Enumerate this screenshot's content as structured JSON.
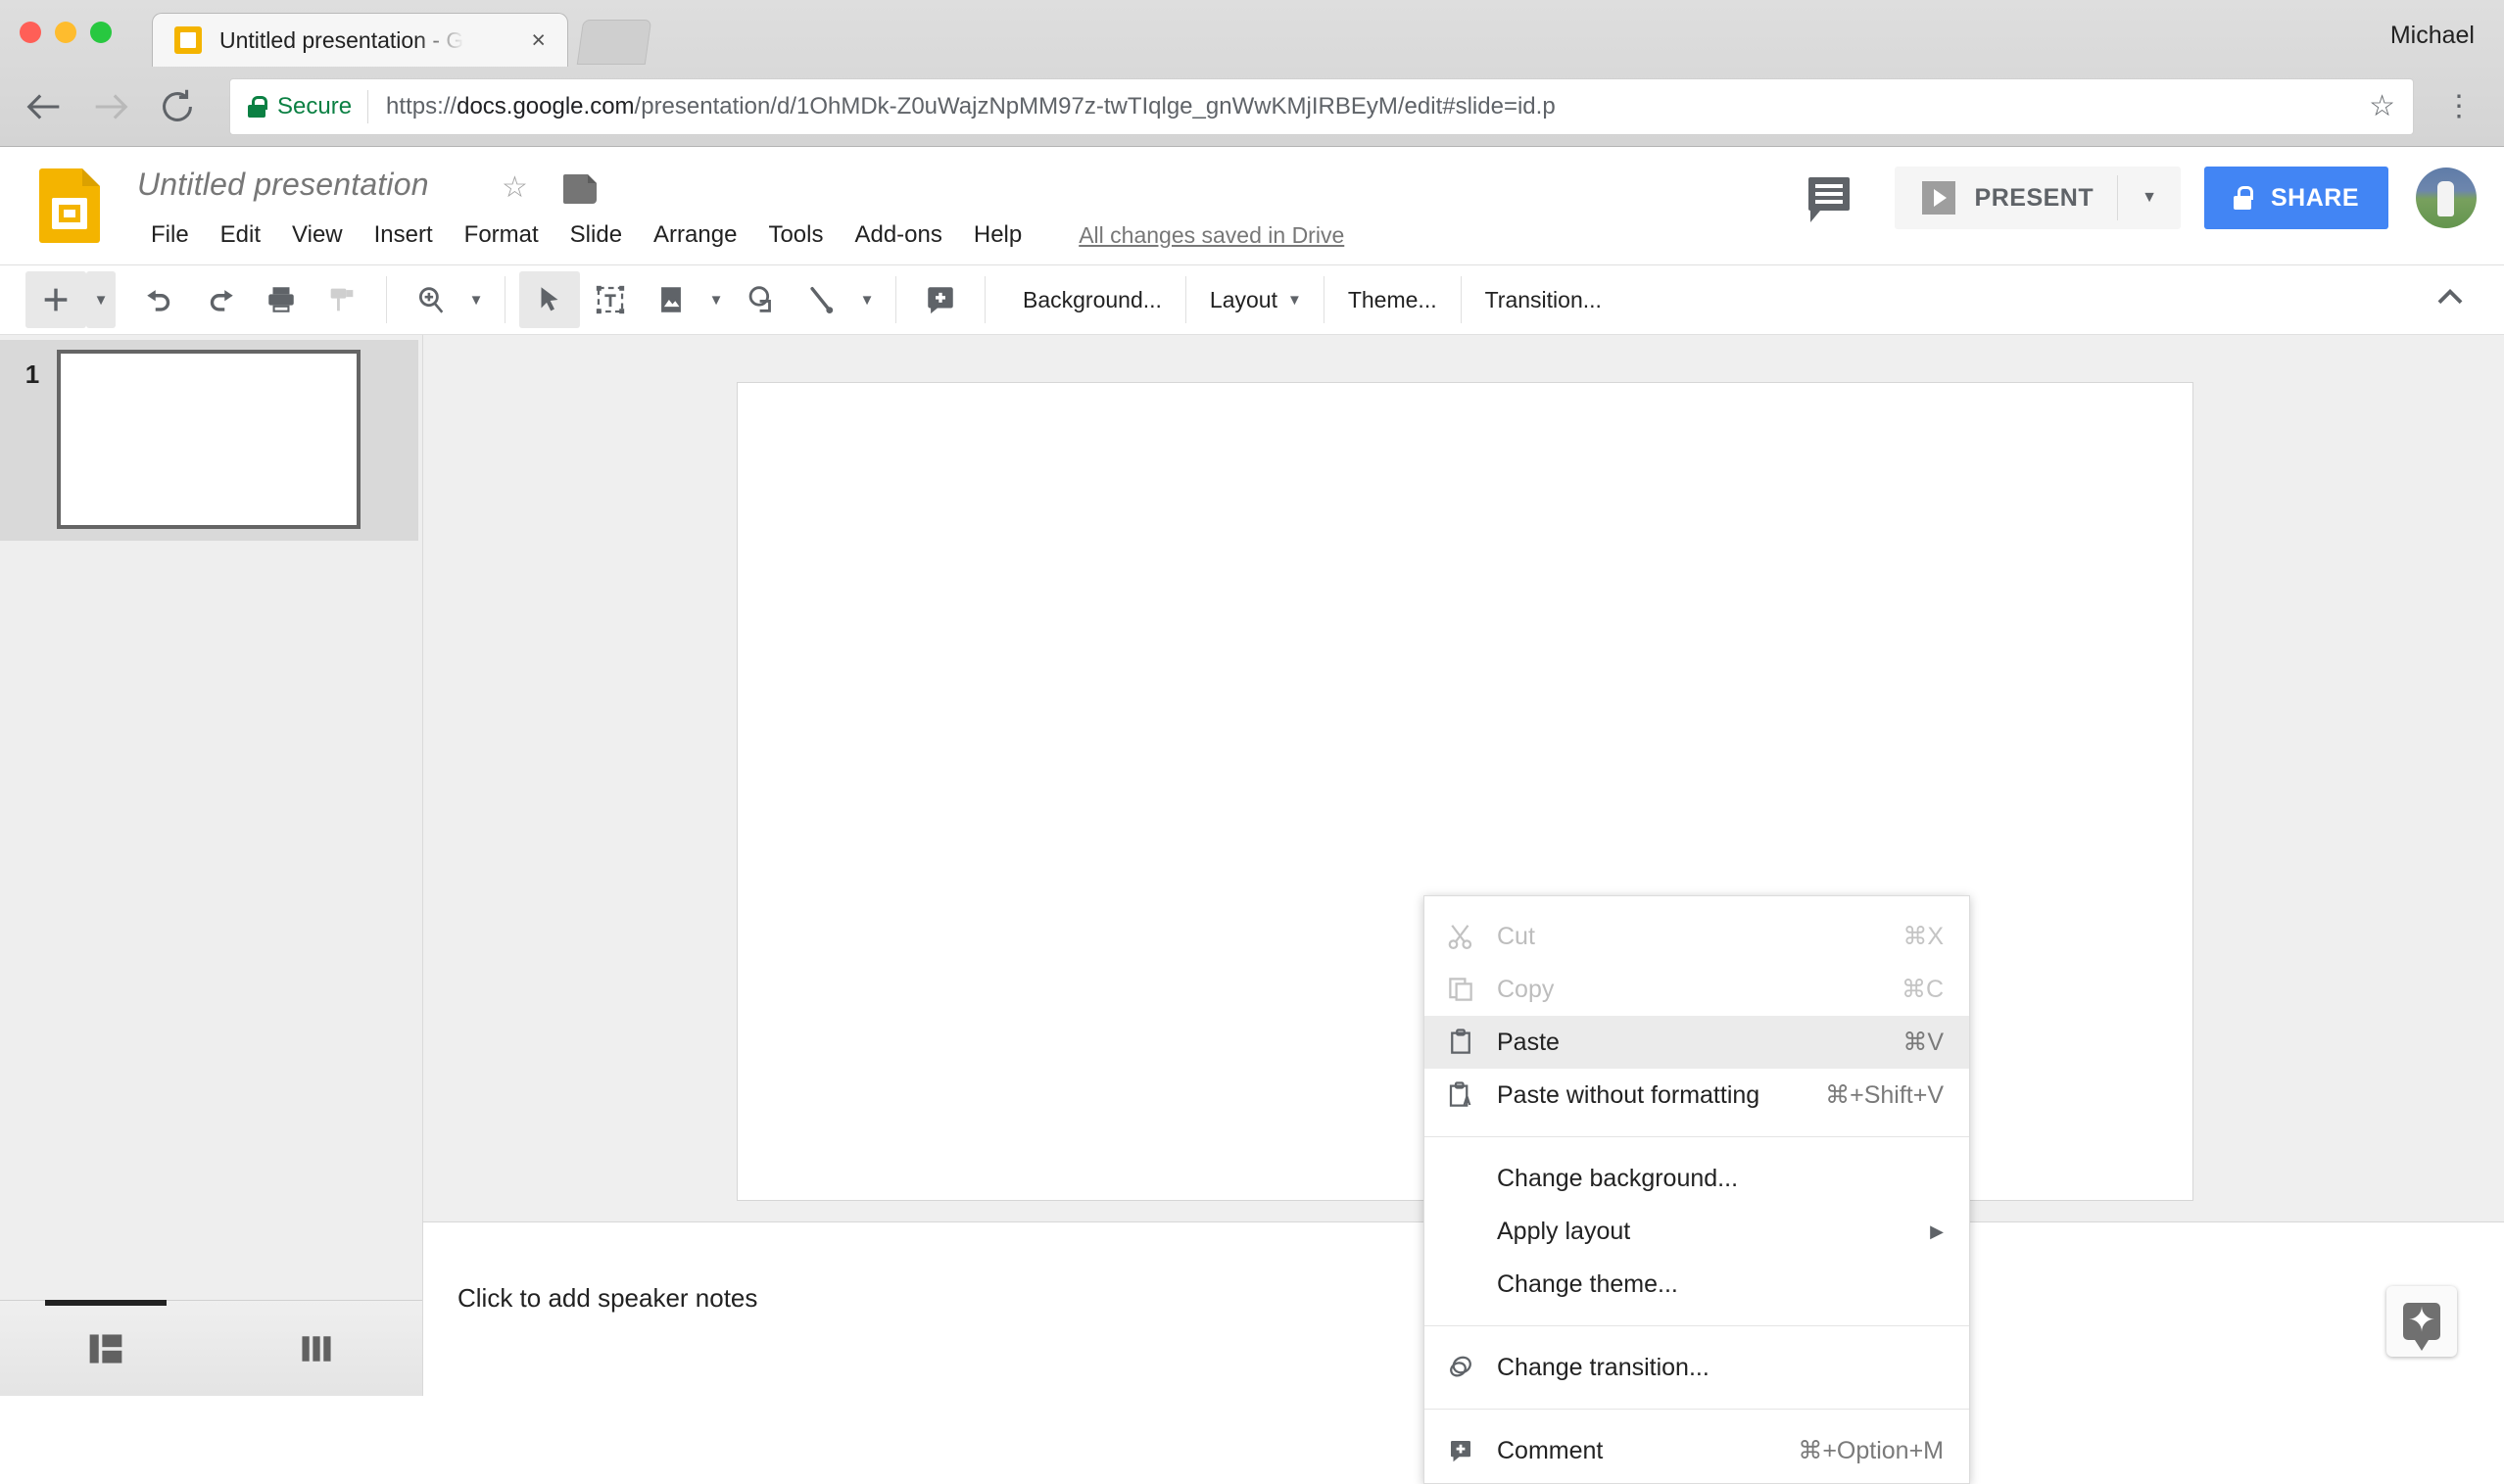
{
  "browser": {
    "tab": {
      "title": "Untitled presentation - Google",
      "favicon": "slides-favicon",
      "close": "×"
    },
    "profile_name": "Michael",
    "omnibox": {
      "security_label": "Secure",
      "url_scheme": "https://",
      "url_host": "docs.google.com",
      "url_path": "/presentation/d/1OhMDk-Z0uWajzNpMM97z-twTIqlge_gnWwKMjIRBEyM/edit#slide=id.p"
    },
    "buttons": {
      "back": "back-arrow",
      "forward": "forward-arrow",
      "reload": "reload",
      "bookmark": "star",
      "menu": "three-dot-menu"
    }
  },
  "docs": {
    "title": "Untitled presentation",
    "menus": [
      "File",
      "Edit",
      "View",
      "Insert",
      "Format",
      "Slide",
      "Arrange",
      "Tools",
      "Add-ons",
      "Help"
    ],
    "save_status": "All changes saved in Drive",
    "present_label": "PRESENT",
    "share_label": "SHARE"
  },
  "toolbar": {
    "items": [
      {
        "name": "new-slide",
        "icon": "plus"
      },
      {
        "name": "undo",
        "icon": "undo"
      },
      {
        "name": "redo",
        "icon": "redo"
      },
      {
        "name": "print",
        "icon": "printer"
      },
      {
        "name": "paint-format",
        "icon": "paint-roller"
      },
      {
        "name": "zoom",
        "icon": "magnifier-plus"
      },
      {
        "name": "select",
        "icon": "cursor-arrow"
      },
      {
        "name": "text-box",
        "icon": "text-box"
      },
      {
        "name": "insert-image",
        "icon": "image"
      },
      {
        "name": "shape",
        "icon": "shape"
      },
      {
        "name": "line",
        "icon": "line"
      },
      {
        "name": "comment",
        "icon": "add-comment"
      }
    ],
    "text_buttons": [
      "Background...",
      "Layout",
      "Theme...",
      "Transition..."
    ],
    "collapse": "chevron-up"
  },
  "filmstrip": {
    "slides": [
      {
        "number": "1"
      }
    ],
    "view_tabs": [
      {
        "name": "filmstrip-view",
        "icon": "filmstrip-icon",
        "selected": true
      },
      {
        "name": "grid-view",
        "icon": "grid-icon",
        "selected": false
      }
    ]
  },
  "editor": {
    "notes_placeholder": "Click to add speaker notes",
    "explore_label": "explore-icon"
  },
  "context_menu": {
    "groups": [
      {
        "items": [
          {
            "label": "Cut",
            "shortcut": "⌘X",
            "icon": "scissors-icon",
            "disabled": true,
            "highlighted": false,
            "submenu": false
          },
          {
            "label": "Copy",
            "shortcut": "⌘C",
            "icon": "copy-icon",
            "disabled": true,
            "highlighted": false,
            "submenu": false
          },
          {
            "label": "Paste",
            "shortcut": "⌘V",
            "icon": "clipboard-icon",
            "disabled": false,
            "highlighted": true,
            "submenu": false
          },
          {
            "label": "Paste without formatting",
            "shortcut": "⌘+Shift+V",
            "icon": "clipboard-text-icon",
            "disabled": false,
            "highlighted": false,
            "submenu": false
          }
        ]
      },
      {
        "items": [
          {
            "label": "Change background...",
            "shortcut": "",
            "icon": "",
            "disabled": false,
            "highlighted": false,
            "submenu": false
          },
          {
            "label": "Apply layout",
            "shortcut": "",
            "icon": "",
            "disabled": false,
            "highlighted": false,
            "submenu": true
          },
          {
            "label": "Change theme...",
            "shortcut": "",
            "icon": "",
            "disabled": false,
            "highlighted": false,
            "submenu": false
          }
        ]
      },
      {
        "items": [
          {
            "label": "Change transition...",
            "shortcut": "",
            "icon": "transition-icon",
            "disabled": false,
            "highlighted": false,
            "submenu": false
          }
        ]
      },
      {
        "items": [
          {
            "label": "Comment",
            "shortcut": "⌘+Option+M",
            "icon": "add-comment-icon",
            "disabled": false,
            "highlighted": false,
            "submenu": false
          }
        ]
      }
    ]
  },
  "colors": {
    "brand_yellow": "#f4b400",
    "share_blue": "#4285f4",
    "secure_green": "#0b8043",
    "highlight": "#ebebeb"
  }
}
